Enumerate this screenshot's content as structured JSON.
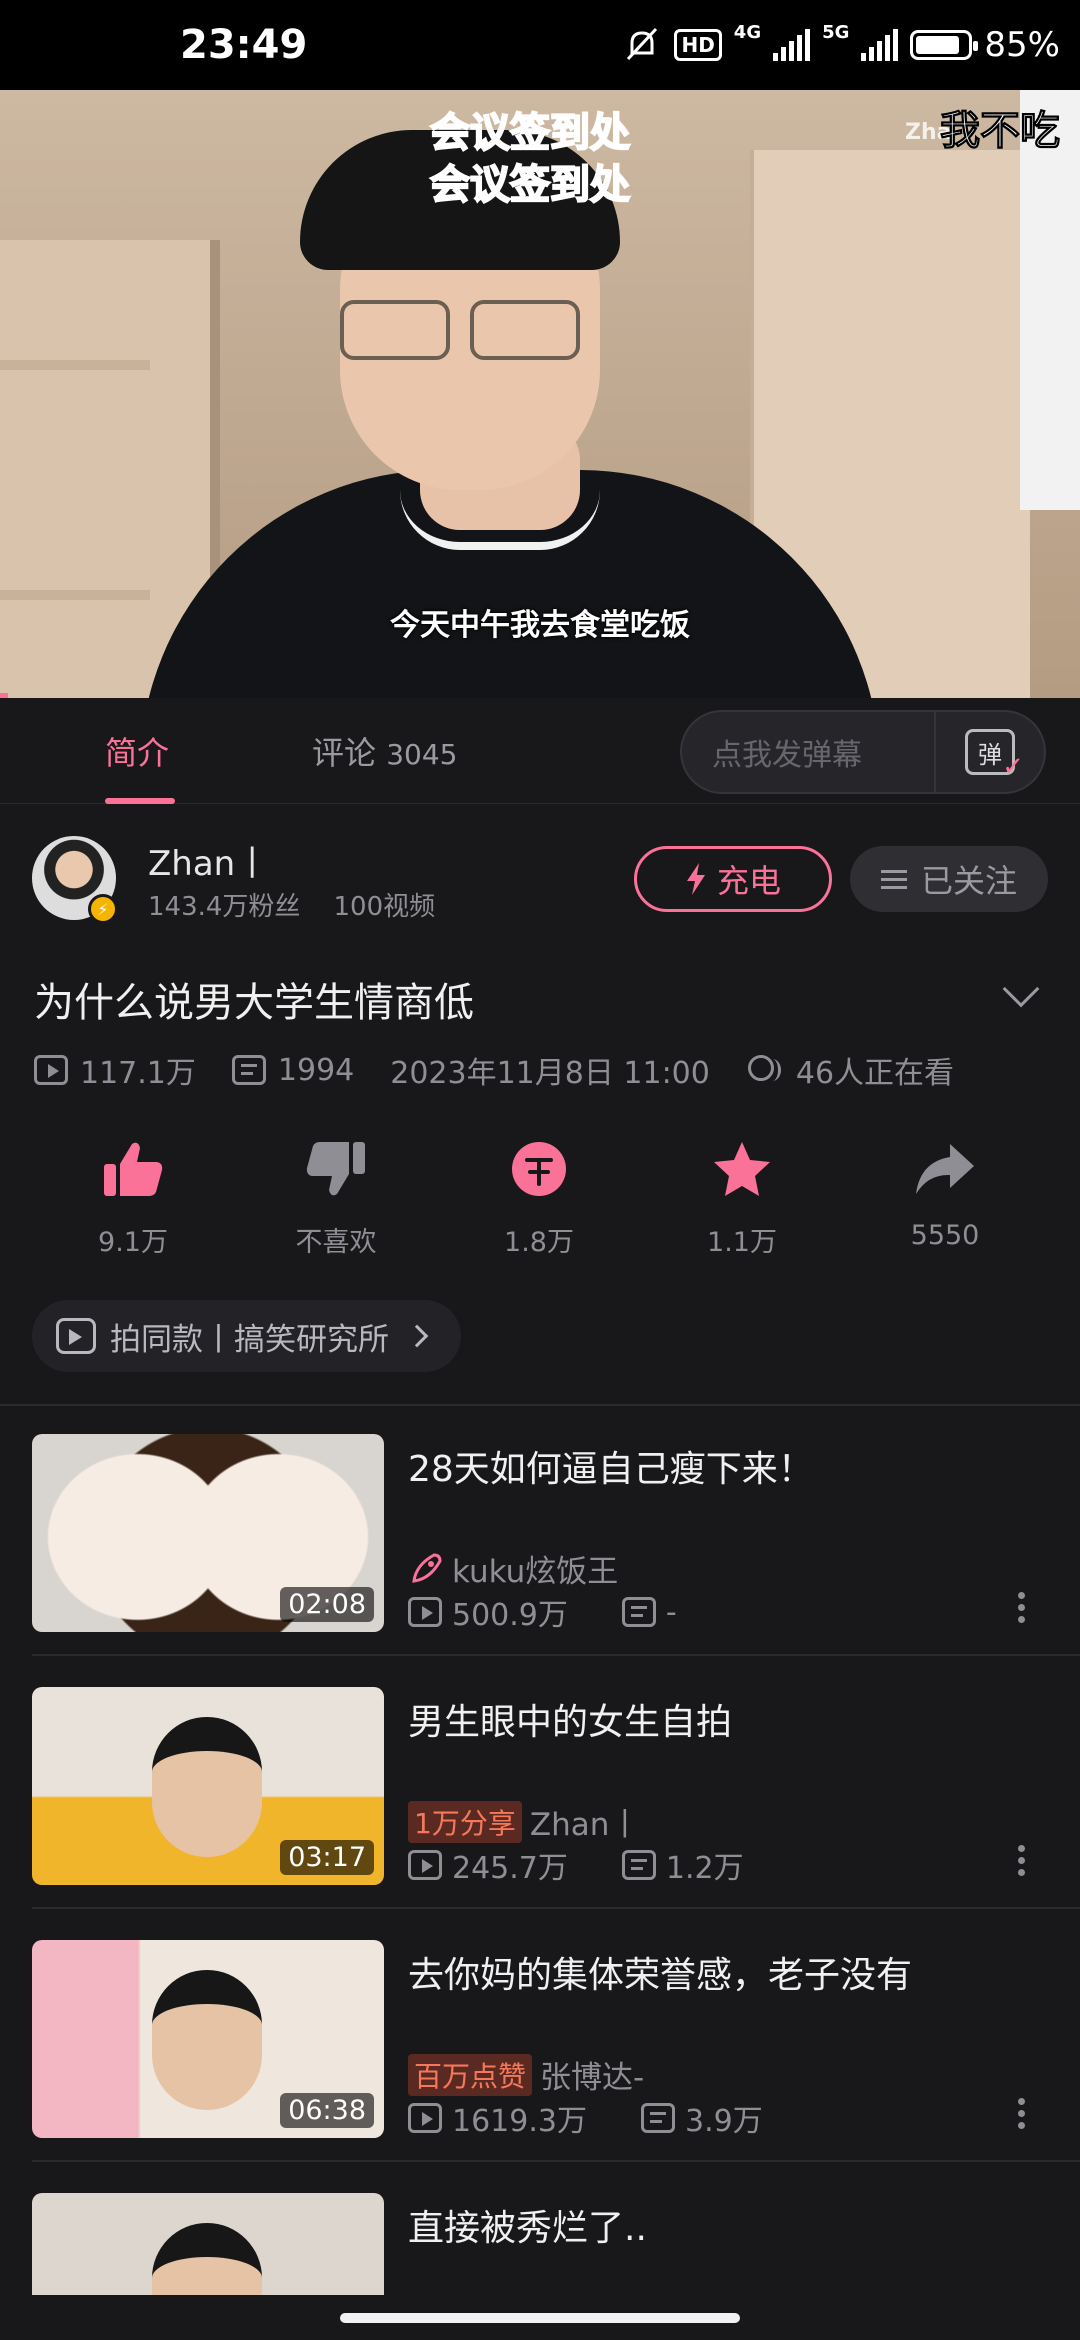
{
  "status_bar": {
    "time": "23:49",
    "network_1": "4G",
    "network_2": "5G",
    "hd": "HD",
    "battery": "85%",
    "battery_level": 0.85
  },
  "video": {
    "overlay_texts": [
      "会议签到处",
      "会议签到处",
      "我不吃",
      "Zha"
    ],
    "subtitle": "今天中午我去食堂吃饭"
  },
  "tabs": {
    "intro": "简介",
    "comments": "评论",
    "comment_count": "3045",
    "danmaku_placeholder": "点我发弹幕",
    "danmaku_icon_text": "弹"
  },
  "uploader": {
    "name": "Zhan丨",
    "fans": "143.4万粉丝",
    "videos": "100视频",
    "charge_label": "充电",
    "follow_label": "已关注"
  },
  "video_info": {
    "title": "为什么说男大学生情商低",
    "views": "117.1万",
    "danmaku": "1994",
    "date": "2023年11月8日 11:00",
    "watching": "46人正在看"
  },
  "actions": [
    {
      "icon": "thumbs-up-icon",
      "label": "9.1万"
    },
    {
      "icon": "thumbs-down-icon",
      "label": "不喜欢"
    },
    {
      "icon": "coin-icon",
      "label": "1.8万"
    },
    {
      "icon": "star-icon",
      "label": "1.1万"
    },
    {
      "icon": "share-icon",
      "label": "5550"
    }
  ],
  "remix_chip": {
    "label": "拍同款丨搞笑研究所"
  },
  "related": [
    {
      "title": "28天如何逼自己瘦下来！",
      "duration": "02:08",
      "tag": "",
      "owner": "kuku炫饭王",
      "views": "500.9万",
      "danmaku": "-"
    },
    {
      "title": "男生眼中的女生自拍",
      "duration": "03:17",
      "tag": "1万分享",
      "owner": "Zhan丨",
      "views": "245.7万",
      "danmaku": "1.2万"
    },
    {
      "title": "去你妈的集体荣誉感，老子没有",
      "duration": "06:38",
      "tag": "百万点赞",
      "owner": "张博达-",
      "views": "1619.3万",
      "danmaku": "3.9万"
    },
    {
      "title": "直接被秀烂了..",
      "duration": "",
      "tag": "",
      "owner": "",
      "views": "",
      "danmaku": ""
    }
  ],
  "colors": {
    "accent": "#fb7299",
    "background": "#18181b",
    "tag_bg": "#5a2a22",
    "tag_text": "#f5785a"
  }
}
